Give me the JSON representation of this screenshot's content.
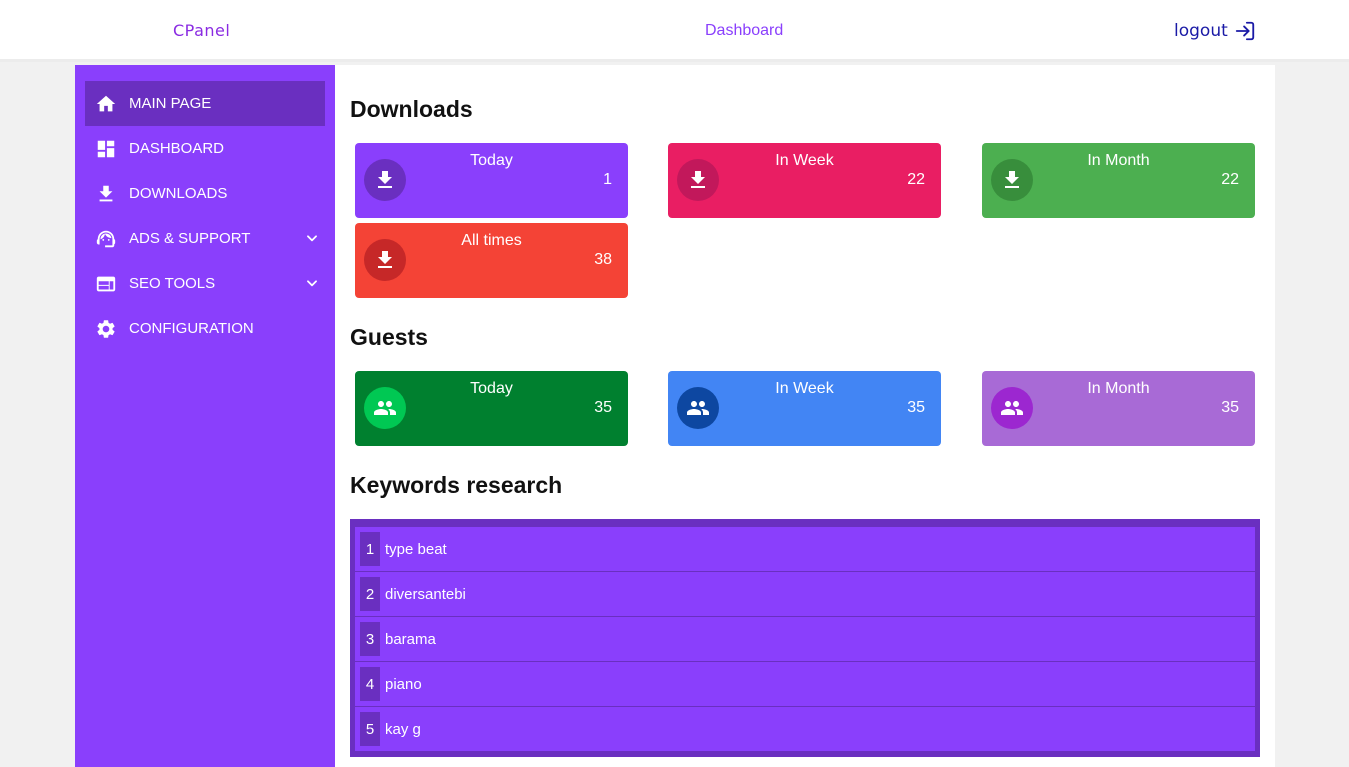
{
  "header": {
    "brand": "CPanel",
    "title": "Dashboard",
    "logout_label": "logout"
  },
  "sidebar": {
    "items": [
      {
        "label": "MAIN PAGE",
        "icon": "home-icon",
        "active": true
      },
      {
        "label": "DASHBOARD",
        "icon": "dashboard-icon"
      },
      {
        "label": "DOWNLOADS",
        "icon": "download-icon"
      },
      {
        "label": "ADS & SUPPORT",
        "icon": "support-agent-icon",
        "has_submenu": true
      },
      {
        "label": "SEO TOOLS",
        "icon": "web-icon",
        "has_submenu": true
      },
      {
        "label": "CONFIGURATION",
        "icon": "gear-icon"
      }
    ]
  },
  "downloads": {
    "title": "Downloads",
    "cards": [
      {
        "label": "Today",
        "value": "1",
        "color": "#8a3ffc",
        "icon_bg": "#6a2fc0"
      },
      {
        "label": "In Week",
        "value": "22",
        "color": "#e91e63",
        "icon_bg": "#c2185b"
      },
      {
        "label": "In Month",
        "value": "22",
        "color": "#4caf50",
        "icon_bg": "#388e3c"
      },
      {
        "label": "All times",
        "value": "38",
        "color": "#f44336",
        "icon_bg": "#c62828"
      }
    ]
  },
  "guests": {
    "title": "Guests",
    "cards": [
      {
        "label": "Today",
        "value": "35",
        "color": "#00802f",
        "icon_bg": "#00c853"
      },
      {
        "label": "In Week",
        "value": "35",
        "color": "#4285f4",
        "icon_bg": "#0d47a1"
      },
      {
        "label": "In Month",
        "value": "35",
        "color": "#a86ad6",
        "icon_bg": "#9c27d0"
      }
    ]
  },
  "keywords": {
    "title": "Keywords research",
    "items": [
      {
        "rank": "1",
        "keyword": "type beat"
      },
      {
        "rank": "2",
        "keyword": "diversantebi"
      },
      {
        "rank": "3",
        "keyword": "barama"
      },
      {
        "rank": "4",
        "keyword": "piano"
      },
      {
        "rank": "5",
        "keyword": "kay g"
      }
    ]
  }
}
